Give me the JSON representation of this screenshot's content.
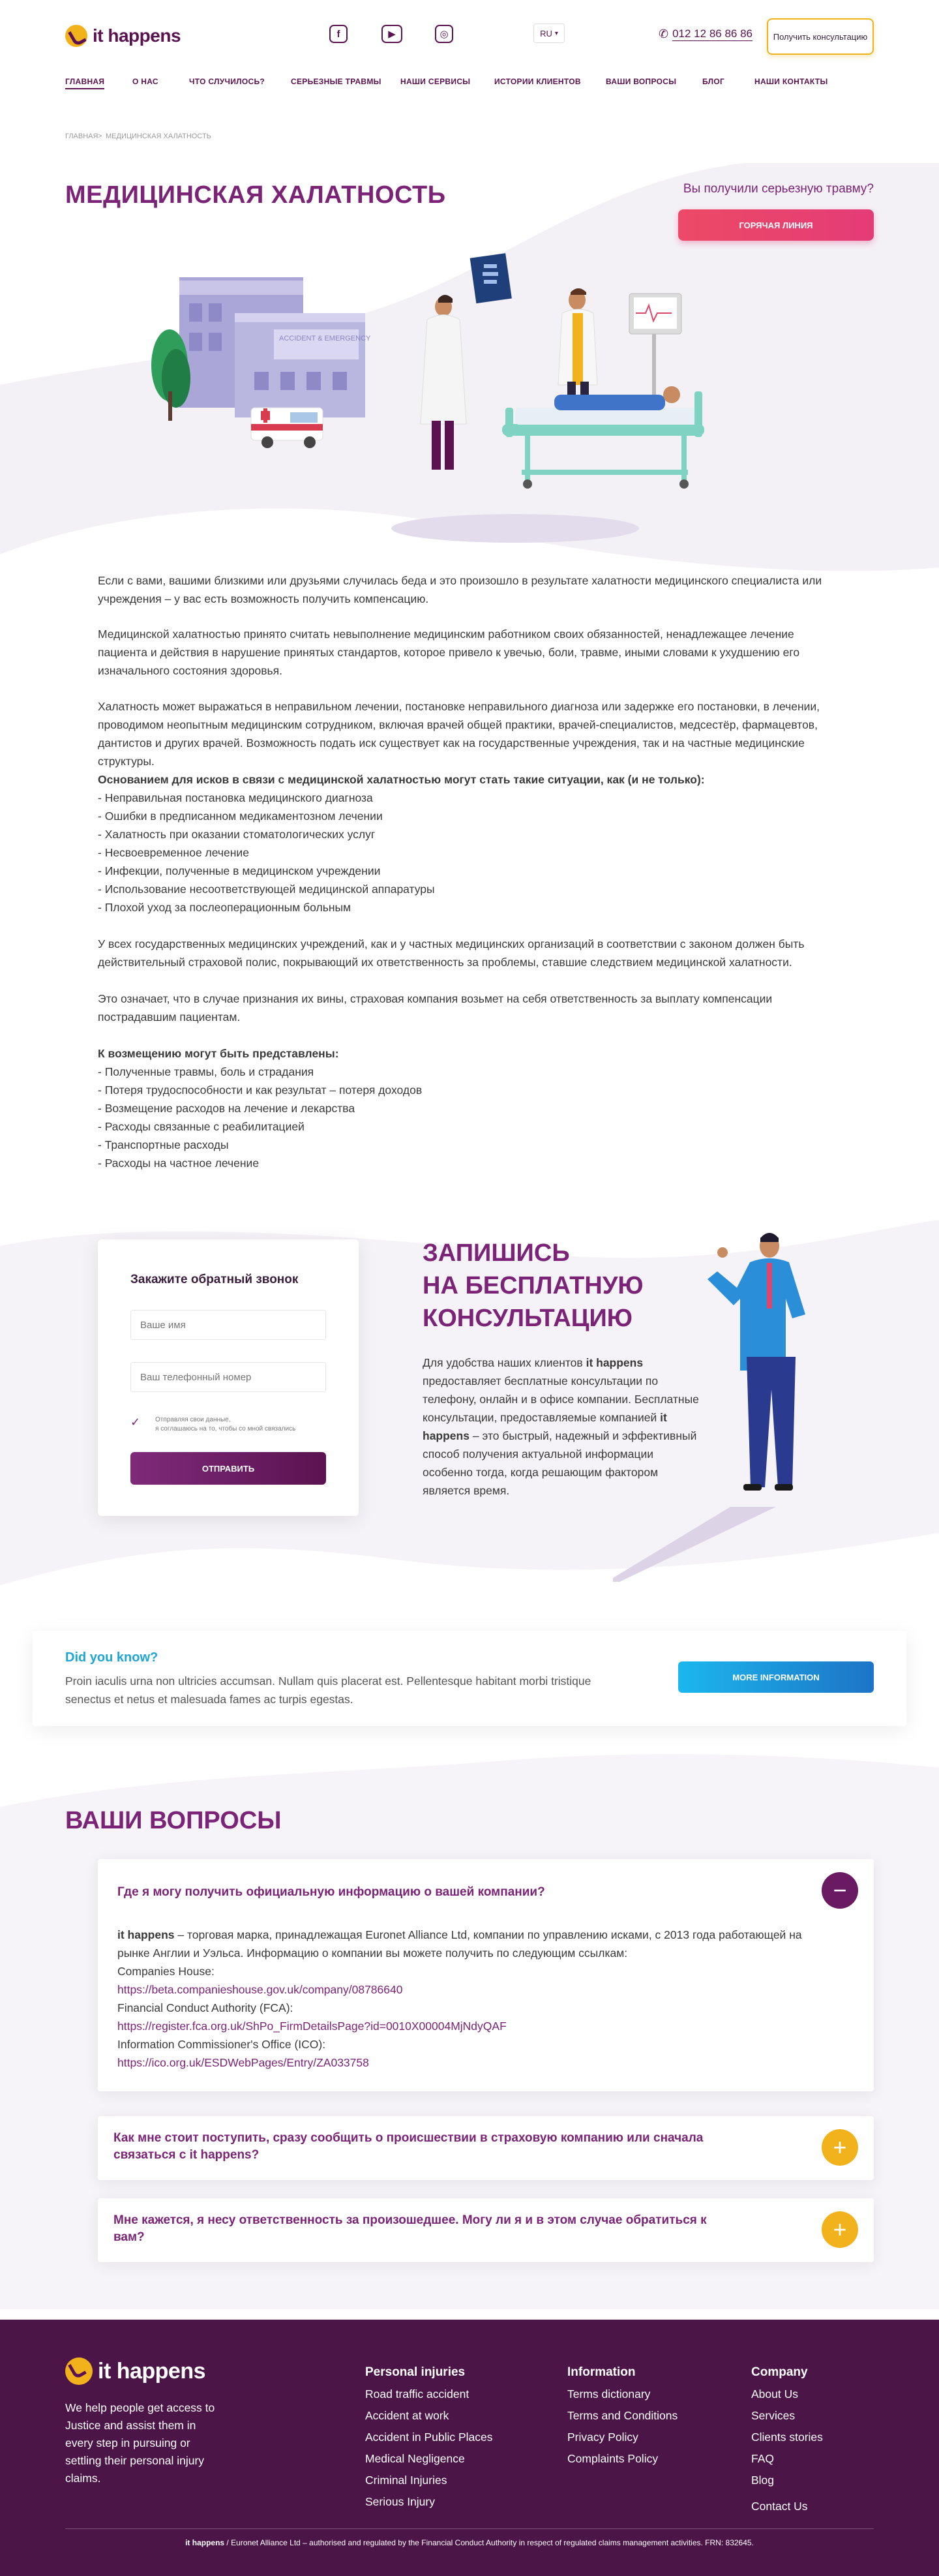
{
  "header": {
    "logo_text": "it happens",
    "social": [
      "facebook-icon",
      "youtube-icon",
      "instagram-icon"
    ],
    "lang": "RU",
    "phone": "012 12 86 86 86",
    "consult_button": "Получить консультацию",
    "nav": [
      "ГЛАВНАЯ",
      "О НАС",
      "ЧТО СЛУЧИЛОСЬ?",
      "СЕРЬЕЗНЫЕ ТРАВМЫ",
      "НАШИ СЕРВИСЫ",
      "ИСТОРИИ КЛИЕНТОВ",
      "ВАШИ ВОПРОСЫ",
      "БЛОГ",
      "НАШИ КОНТАКТЫ"
    ]
  },
  "breadcrumb": {
    "home": "ГЛАВНАЯ",
    "sep": ">",
    "current": "МЕДИЦИНСКАЯ ХАЛАТНОСТЬ"
  },
  "hero": {
    "title": "МЕДИЦИНСКАЯ ХАЛАТНОСТЬ",
    "question": "Вы получили серьезную травму?",
    "hotline": "ГОРЯЧАЯ ЛИНИЯ",
    "building_sign": "ACCIDENT & EMERGENCY"
  },
  "content": {
    "p1": "Если с вами, вашими близкими или друзьями случилась беда и это произошло в результате халатности медицинского специалиста или учреждения – у вас есть возможность получить компенсацию.",
    "p2": "Медицинской халатностью принято считать невыполнение медицинским работником своих обязанностей, ненадлежащее лечение пациента и действия в нарушение принятых стандартов, которое привело к увечью, боли, травме, иными словами к ухудшению его изначального состояния здоровья.",
    "p3": "Халатность может выражаться в неправильном лечении, постановке неправильного диагноза или задержке его постановки, в лечении, проводимом неопытным медицинским сотрудником, включая врачей общей практики, врачей-специалистов, медсестёр, фармацевтов, дантистов и других врачей. Возможность подать иск существует как на государственные учреждения, так и на частные медицинские структуры.",
    "list1_title": "Основанием для исков в связи с медицинской халатностью могут стать такие ситуации, как (и не только):",
    "list1": [
      "- Неправильная постановка медицинского диагноза",
      "- Ошибки в предписанном медикаментозном лечении",
      "- Халатность при оказании стоматологических услуг",
      "- Несвоевременное лечение",
      "- Инфекции, полученные в медицинском учреждении",
      "- Использование несоответствующей медицинской аппаратуры",
      "- Плохой уход за послеоперационным больным"
    ],
    "p4": "У всех государственных медицинских учреждений, как и у частных медицинских организаций в соответствии с законом должен быть действительный страховой полис, покрывающий их ответственность за проблемы, ставшие следствием медицинской халатности.",
    "p5": "Это означает, что в случае признания их вины, страховая компания возьмет на себя ответственность за выплату компенсации пострадавшим пациентам.",
    "list2_title": "К возмещению могут быть представлены:",
    "list2": [
      "- Полученные травмы, боль и страдания",
      "- Потеря трудоспособности и как результат – потеря доходов",
      "- Возмещение расходов на лечение и лекарства",
      "- Расходы связанные с реабилитацией",
      "- Транспортные расходы",
      "- Расходы на частное лечение"
    ]
  },
  "form": {
    "title": "Закажите обратный звонок",
    "name_placeholder": "Ваше имя",
    "phone_placeholder": "Ваш телефонный номер",
    "consent_1": "Отправляя свои данные,",
    "consent_2": "я соглашаюсь на то, чтобы со мной связались",
    "submit": "ОТПРАВИТЬ"
  },
  "cta": {
    "line1": "ЗАПИШИСЬ",
    "line2": "НА БЕСПЛАТНУЮ",
    "line3": "КОНСУЛЬТАЦИЮ",
    "t1": "Для удобства наших клиентов ",
    "brand": "it happens",
    "t2": " предоставляет бесплатные консультации по телефону, онлайн и в офисе компании. Бесплатные консультации, предоставляемые компанией ",
    "t3": " – это быстрый, надежный и эффективный способ получения актуальной информации особенно тогда, когда решающим фактором является время."
  },
  "dyk": {
    "title": "Did you know?",
    "text": "Proin iaculis urna non ultricies accumsan. Nullam quis placerat est. Pellentesque habitant morbi tristique senectus et netus et malesuada fames ac turpis egestas.",
    "button": "MORE INFORMATION"
  },
  "faq": {
    "title": "ВАШИ ВОПРОСЫ",
    "q1": "Где я могу получить официальную информацию о вашей компании?",
    "a1_brand": "it happens",
    "a1_text": " – торговая марка, принадлежащая Euronet Alliance Ltd, компании по управлению исками, с 2013 года работающей на рынке Англии и Уэльса. Информацию о компании вы можете получить по следующим ссылкам:",
    "a1_l1": "Companies House:",
    "a1_u1": "https://beta.companieshouse.gov.uk/company/08786640",
    "a1_l2": "Financial Conduct Authority (FCA):",
    "a1_u2": "https://register.fca.org.uk/ShPo_FirmDetailsPage?id=0010X00004MjNdyQAF",
    "a1_l3": "Information Commissioner's Office (ICO):",
    "a1_u3": "https://ico.org.uk/ESDWebPages/Entry/ZA033758",
    "q2a": "Как мне стоит поступить, сразу сообщить о происшествии в страховую компанию или сначала",
    "q2b": "связаться с it happens?",
    "q3a": "Мне кажется, я несу ответственность за произошедшее. Могу ли я и в этом случае обратиться к",
    "q3b": "вам?",
    "minus": "−",
    "plus": "+"
  },
  "footer": {
    "logo_text": "it happens",
    "tagline": "We help people get access to Justice and assist them in every step in pursuing or settling their personal injury claims.",
    "col1_title": "Personal injuries",
    "col1": [
      "Road traffic accident",
      "Accident at work",
      "Accident in Public Places",
      "Medical Negligence",
      "Criminal Injuries",
      "Serious Injury"
    ],
    "col2_title": "Information",
    "col2": [
      "Terms dictionary",
      "Terms and Conditions",
      "Privacy Policy",
      "Complaints Policy"
    ],
    "col3_title": "Company",
    "col3": [
      "About Us",
      "Services",
      "Clients stories",
      "FAQ",
      "Blog",
      "Contact Us"
    ],
    "copy_brand": "it happens",
    "copy_text": " / Euronet Alliance Ltd – authorised and regulated by the Financial Conduct Authority in respect of regulated claims management activities. FRN: 832645."
  },
  "colors": {
    "brand_purple": "#7b2377",
    "dark_purple": "#4c1548",
    "yellow": "#f2b21c",
    "pink": "#e43b77",
    "blue": "#1bb7ee"
  }
}
